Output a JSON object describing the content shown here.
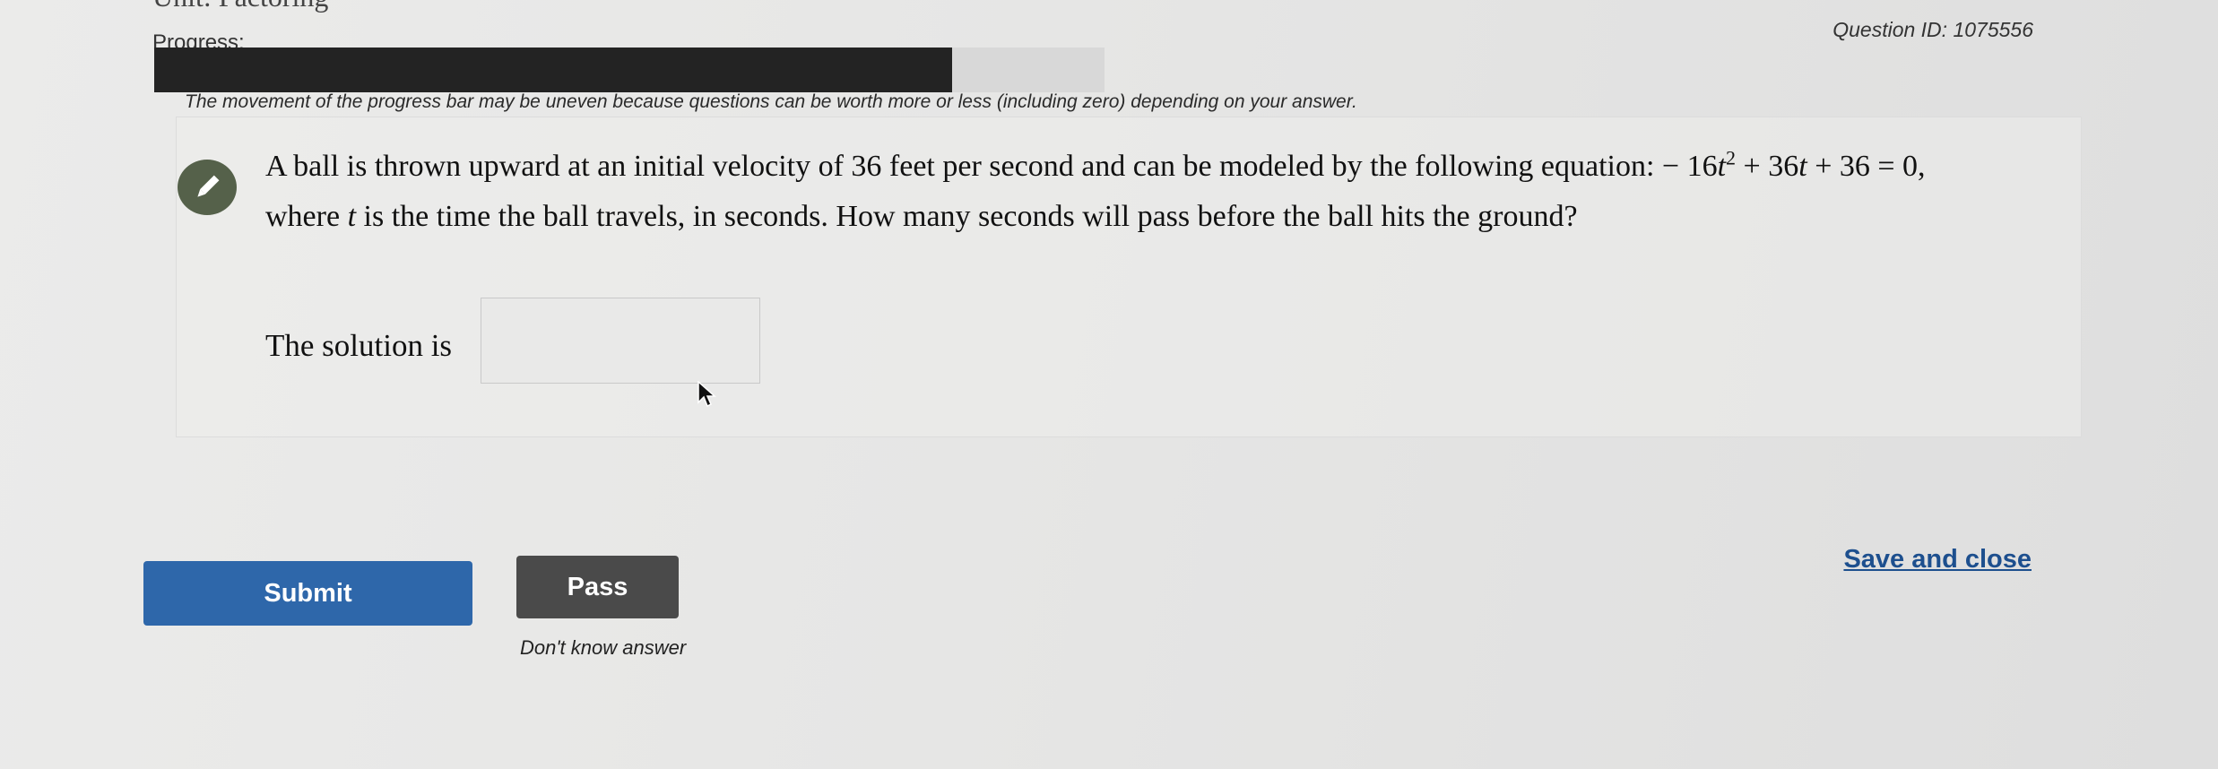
{
  "header": {
    "cut_title": "Unit: Factoring",
    "progress_label": "Progress:",
    "question_id": "Question ID: 1075556",
    "progress_percent": 84,
    "progress_note": "The movement of the progress bar may be uneven because questions can be worth more or less (including zero) depending on your answer."
  },
  "question": {
    "text_1": "A ball is thrown upward at an initial velocity of 36 feet per second and can be modeled by the following equation: − 16",
    "var_t": "t",
    "exp_2": "2",
    "text_2": " + 36",
    "text_3": " + 36 = 0,",
    "text_4": "where ",
    "text_5": " is the time the ball travels, in seconds. How many seconds will pass before the ball hits the ground?",
    "solution_label": "The solution is",
    "answer_value": ""
  },
  "actions": {
    "submit_label": "Submit",
    "pass_label": "Pass",
    "dont_know_label": "Don't know answer",
    "save_close_label": "Save and close"
  },
  "colors": {
    "submit": "#2e67aa",
    "pass": "#4a4a4a",
    "progress_fill": "#232323",
    "link": "#1d4f8e",
    "badge": "#55614a"
  }
}
